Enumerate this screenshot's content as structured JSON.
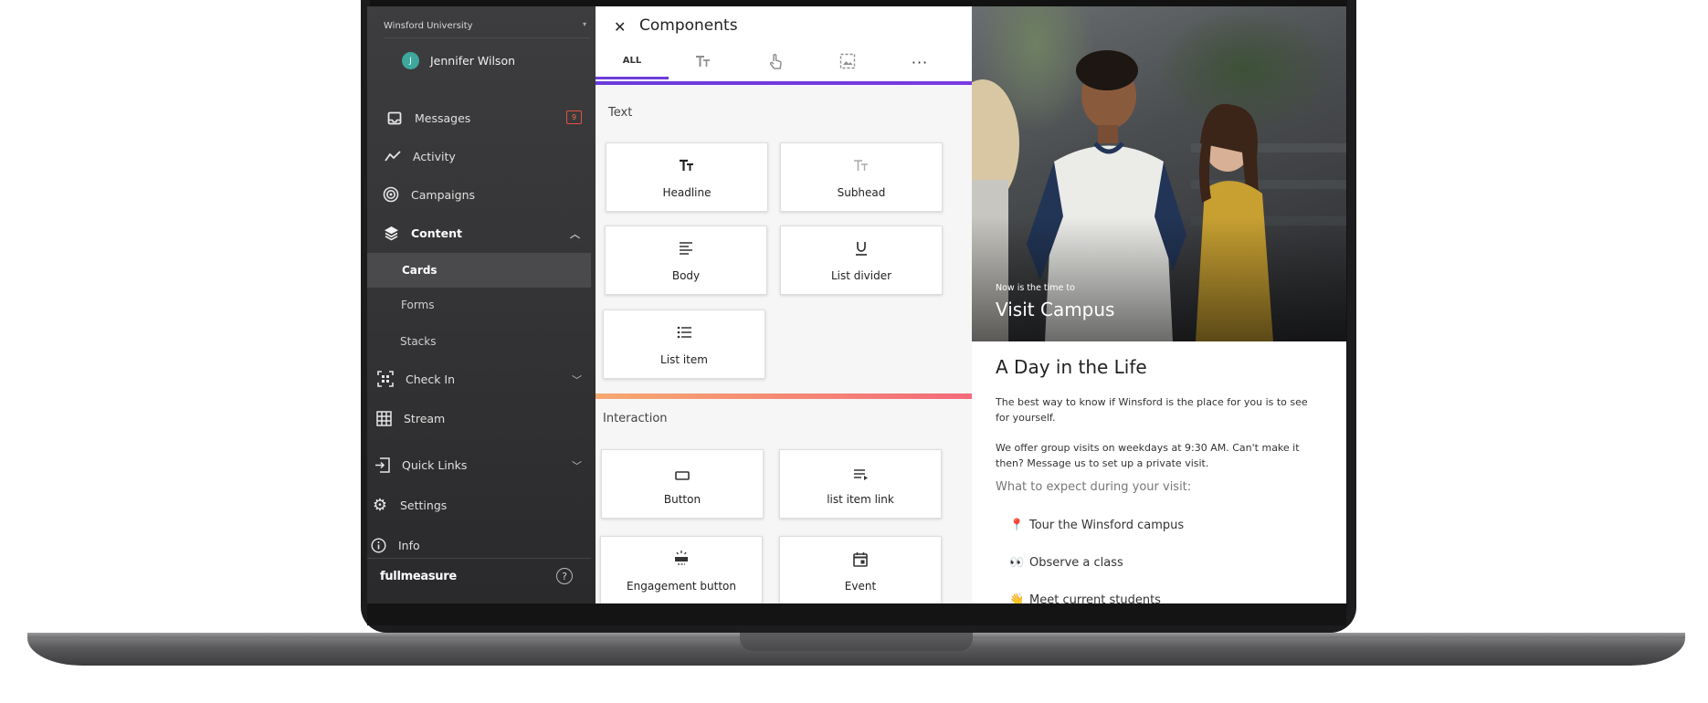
{
  "sidebar": {
    "org_name": "Winsford University",
    "user": {
      "initial": "J",
      "name": "Jennifer Wilson"
    },
    "items": [
      {
        "label": "Messages",
        "badge": "9"
      },
      {
        "label": "Activity"
      },
      {
        "label": "Campaigns"
      },
      {
        "label": "Content"
      },
      {
        "label": "Check In"
      },
      {
        "label": "Stream"
      },
      {
        "label": "Quick Links"
      },
      {
        "label": "Settings"
      },
      {
        "label": "Info"
      }
    ],
    "content_sub": [
      "Cards",
      "Forms",
      "Stacks"
    ],
    "active_sub": "Cards",
    "brand": "fullmeasure",
    "help": "?"
  },
  "components": {
    "title": "Components",
    "tabs": [
      {
        "label": "ALL",
        "icon": "all"
      },
      {
        "label": "",
        "icon": "text-size-icon"
      },
      {
        "label": "",
        "icon": "touch-icon"
      },
      {
        "label": "",
        "icon": "image-icon"
      },
      {
        "label": "",
        "icon": "more-icon"
      }
    ],
    "sections": [
      {
        "label": "Text",
        "cards": [
          "Headline",
          "Subhead",
          "Body",
          "List divider",
          "List item"
        ]
      },
      {
        "label": "Interaction",
        "cards": [
          "Button",
          "list item link",
          "Engagement button",
          "Event"
        ]
      }
    ],
    "colors": {
      "accent": "#6c3fd8",
      "section_bar": "#f36a7a"
    }
  },
  "preview": {
    "hero_kicker": "Now is the time to",
    "hero_title": "Visit Campus",
    "title": "A Day in the Life",
    "para1": "The best way to know if Winsford is the place for you is to see for yourself.",
    "para2": "We offer group visits on weekdays at 9:30 AM. Can't make it then? Message us to set up a private visit.",
    "subheading": "What to expect during your visit:",
    "list": [
      {
        "emoji": "📍",
        "text": "Tour the Winsford campus"
      },
      {
        "emoji": "👀",
        "text": "Observe a class"
      },
      {
        "emoji": "👋",
        "text": "Meet current students"
      }
    ]
  }
}
